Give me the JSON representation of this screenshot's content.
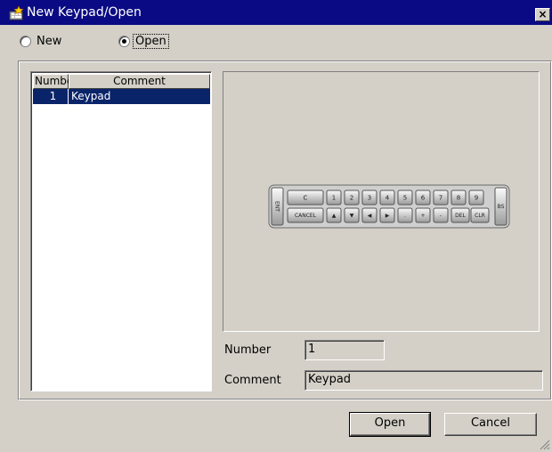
{
  "window": {
    "title": "New Keypad/Open",
    "close_label": "×"
  },
  "mode": {
    "options": [
      {
        "label": "New",
        "checked": false
      },
      {
        "label": "Open",
        "checked": true
      }
    ]
  },
  "list": {
    "columns": [
      "Number",
      "Comment"
    ],
    "rows": [
      {
        "number": "1",
        "comment": "Keypad"
      }
    ]
  },
  "preview": {
    "keypad_side_label": "ENT",
    "top_keys": [
      "C",
      "1",
      "2",
      "3",
      "4",
      "5",
      "6",
      "7",
      "8",
      "9"
    ],
    "bottom_keys": [
      "CANCEL",
      "▲",
      "▼",
      "◀",
      "▶",
      ".",
      "+",
      "-",
      "DEL",
      "CLR"
    ],
    "bs_label": "BS"
  },
  "fields": {
    "number_label": "Number",
    "number_value": "1",
    "comment_label": "Comment",
    "comment_value": "Keypad"
  },
  "buttons": {
    "open": "Open",
    "cancel": "Cancel"
  },
  "colors": {
    "titlebar": "#0a0a84",
    "selection": "#0a246a",
    "face": "#d4d0c8"
  }
}
